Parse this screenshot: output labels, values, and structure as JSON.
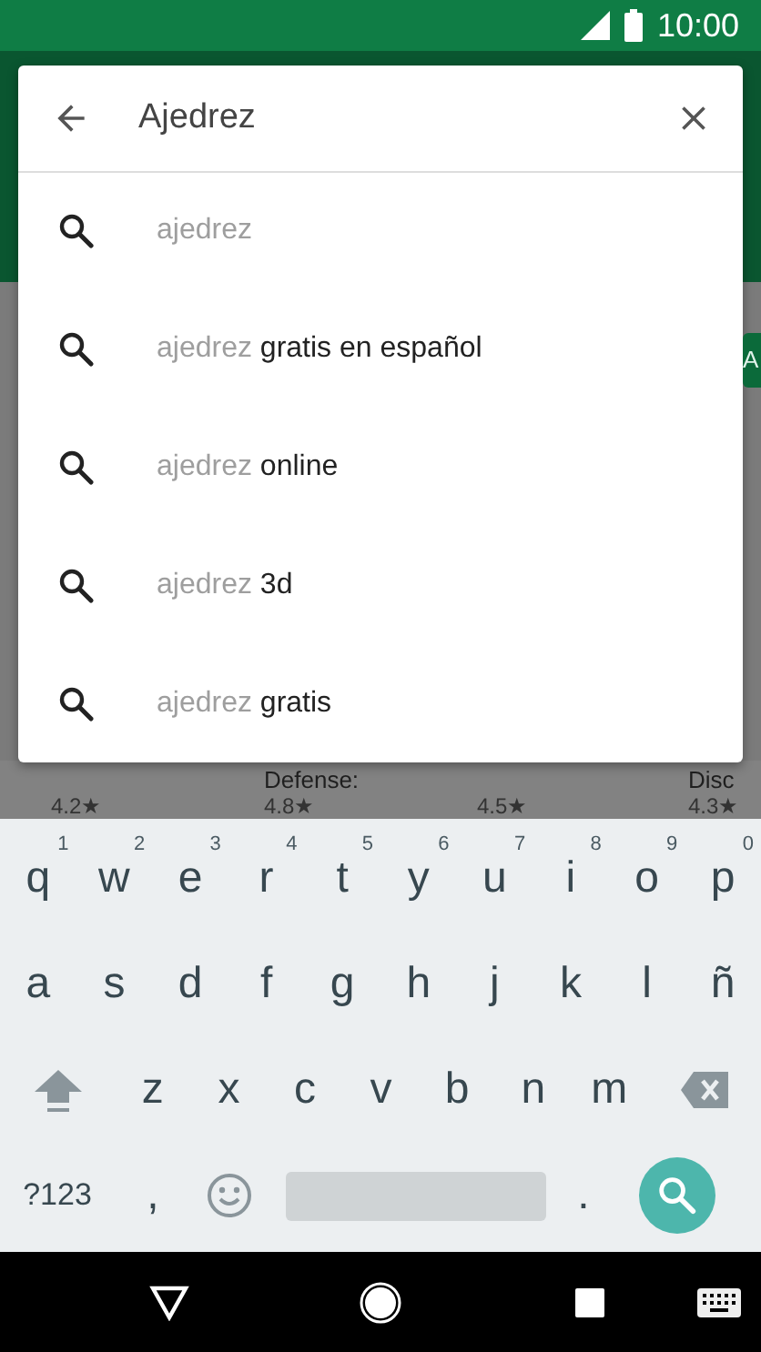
{
  "status_bar": {
    "time": "10:00"
  },
  "behind": {
    "chip": "A",
    "cards": [
      {
        "rating": "4.2★"
      },
      {
        "title": "Defense:",
        "rating": "4.8★"
      },
      {
        "rating": "4.5★"
      },
      {
        "title": "Disc",
        "rating": "4.3★"
      }
    ]
  },
  "search": {
    "value": "Ajedrez"
  },
  "suggestions": [
    {
      "typed": "ajedrez"
    },
    {
      "typed": "ajedrez",
      "completion": "gratis en español"
    },
    {
      "typed": "ajedrez",
      "completion": "online"
    },
    {
      "typed": "ajedrez",
      "completion": "3d"
    },
    {
      "typed": "ajedrez",
      "completion": "gratis"
    }
  ],
  "keyboard": {
    "rows": [
      [
        {
          "kind": "letter",
          "label": "q",
          "hint": "1"
        },
        {
          "kind": "letter",
          "label": "w",
          "hint": "2"
        },
        {
          "kind": "letter",
          "label": "e",
          "hint": "3"
        },
        {
          "kind": "letter",
          "label": "r",
          "hint": "4"
        },
        {
          "kind": "letter",
          "label": "t",
          "hint": "5"
        },
        {
          "kind": "letter",
          "label": "y",
          "hint": "6"
        },
        {
          "kind": "letter",
          "label": "u",
          "hint": "7"
        },
        {
          "kind": "letter",
          "label": "i",
          "hint": "8"
        },
        {
          "kind": "letter",
          "label": "o",
          "hint": "9"
        },
        {
          "kind": "letter",
          "label": "p",
          "hint": "0"
        }
      ],
      [
        {
          "kind": "letter",
          "label": "a"
        },
        {
          "kind": "letter",
          "label": "s"
        },
        {
          "kind": "letter",
          "label": "d"
        },
        {
          "kind": "letter",
          "label": "f"
        },
        {
          "kind": "letter",
          "label": "g"
        },
        {
          "kind": "letter",
          "label": "h"
        },
        {
          "kind": "letter",
          "label": "j"
        },
        {
          "kind": "letter",
          "label": "k"
        },
        {
          "kind": "letter",
          "label": "l"
        },
        {
          "kind": "letter",
          "label": "ñ"
        }
      ],
      [
        {
          "kind": "shift"
        },
        {
          "kind": "letter",
          "label": "z"
        },
        {
          "kind": "letter",
          "label": "x"
        },
        {
          "kind": "letter",
          "label": "c"
        },
        {
          "kind": "letter",
          "label": "v"
        },
        {
          "kind": "letter",
          "label": "b"
        },
        {
          "kind": "letter",
          "label": "n"
        },
        {
          "kind": "letter",
          "label": "m"
        },
        {
          "kind": "backspace"
        }
      ],
      [
        {
          "kind": "symbols",
          "label": "?123"
        },
        {
          "kind": "letter",
          "label": ","
        },
        {
          "kind": "emoji"
        },
        {
          "kind": "space"
        },
        {
          "kind": "letter",
          "label": "."
        },
        {
          "kind": "search"
        }
      ]
    ]
  }
}
